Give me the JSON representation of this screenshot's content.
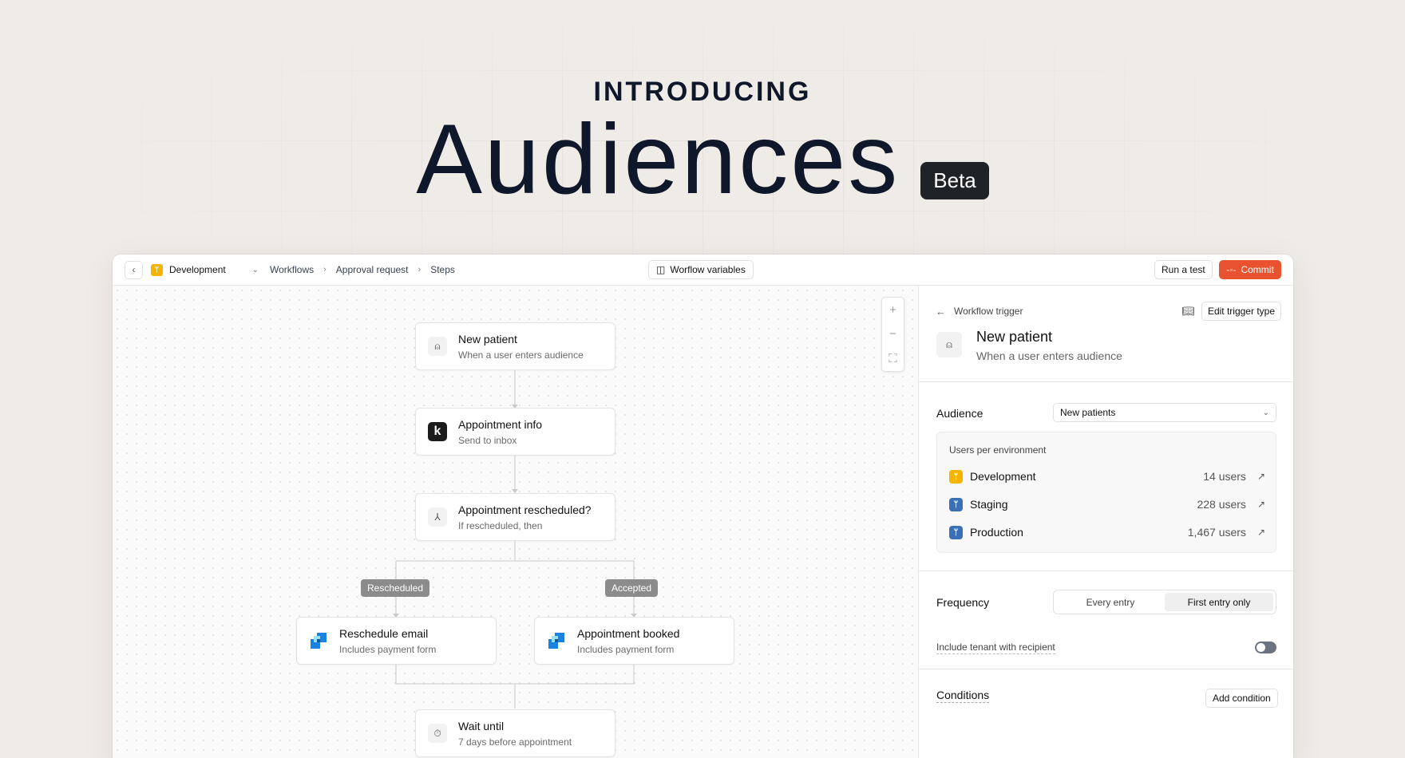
{
  "hero": {
    "eyebrow": "INTRODUCING",
    "title": "Audiences",
    "badge": "Beta"
  },
  "topbar": {
    "environment": "Development",
    "breadcrumbs": [
      "Workflows",
      "Approval request",
      "Steps"
    ],
    "variables_button": "Worflow variables",
    "run_test_button": "Run a test",
    "commit_button": "Commit"
  },
  "canvas": {
    "nodes": [
      {
        "title": "New patient",
        "subtitle": "When a user enters audience",
        "icon": "user-check-icon"
      },
      {
        "title": "Appointment info",
        "subtitle": "Send to inbox",
        "icon": "k-logo-icon"
      },
      {
        "title": "Appointment rescheduled?",
        "subtitle": "If rescheduled, then",
        "icon": "branch-icon"
      },
      {
        "title": "Reschedule email",
        "subtitle": "Includes payment form",
        "icon": "email-provider-icon"
      },
      {
        "title": "Appointment booked",
        "subtitle": "Includes payment form",
        "icon": "email-provider-icon"
      },
      {
        "title": "Wait until",
        "subtitle": "7 days before appointment",
        "icon": "timer-icon"
      }
    ],
    "branches": [
      "Rescheduled",
      "Accepted"
    ],
    "zoom": {
      "in": "+",
      "out": "−",
      "fit": "⛶"
    }
  },
  "panel": {
    "header_label": "Workflow trigger",
    "edit_button": "Edit trigger type",
    "trigger_title": "New patient",
    "trigger_subtitle": "When a user enters audience",
    "audience_label": "Audience",
    "audience_value": "New patients",
    "users_title": "Users per environment",
    "environments": [
      {
        "name": "Development",
        "count": "14 users",
        "color": "#f6b300"
      },
      {
        "name": "Staging",
        "count": "228 users",
        "color": "#3b6fb6"
      },
      {
        "name": "Production",
        "count": "1,467 users",
        "color": "#3b6fb6"
      }
    ],
    "frequency_label": "Frequency",
    "frequency_options": [
      "Every entry",
      "First entry only"
    ],
    "frequency_selected": "First entry only",
    "tenant_label": "Include tenant with recipient",
    "tenant_enabled": false,
    "conditions_label": "Conditions",
    "add_condition_button": "Add condition"
  },
  "colors": {
    "accent": "#e8522f",
    "background": "#efece7"
  }
}
